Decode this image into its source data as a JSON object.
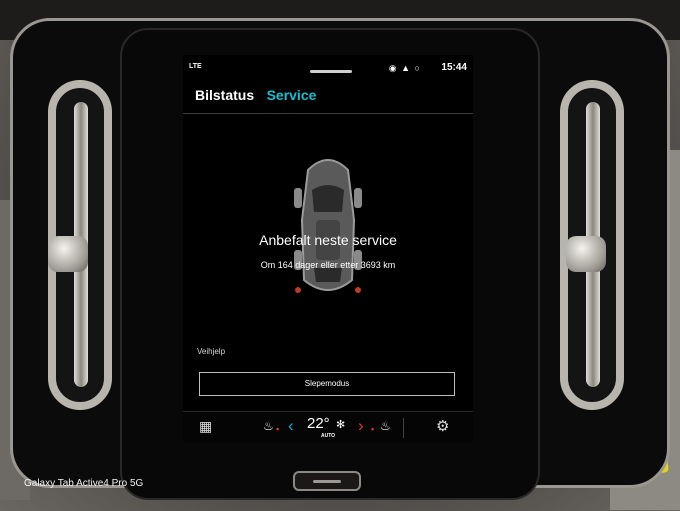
{
  "statusbar": {
    "signal": "LTE",
    "icons": "◉ ▲ ○",
    "time": "15:44"
  },
  "tabs": [
    {
      "label": "Bilstatus",
      "active": false
    },
    {
      "label": "Service",
      "active": true
    }
  ],
  "service": {
    "title": "Anbefalt neste service",
    "subtitle": "Om 164 dager eller etter 3693 km"
  },
  "roadside": {
    "section_label": "Veihjelp",
    "tow_mode_label": "Slepemodus"
  },
  "climate_bar": {
    "apps_icon": "apps-grid-icon",
    "temperature": "22°",
    "mode_label": "AUTO",
    "left_arrow": "‹",
    "right_arrow": "›",
    "settings_icon": "gear-icon"
  },
  "colors": {
    "accent": "#19c0d2",
    "heat": "#e23a2c",
    "cool": "#19a8e0"
  },
  "device_watermark": "Galaxy Tab Active4 Pro 5G"
}
